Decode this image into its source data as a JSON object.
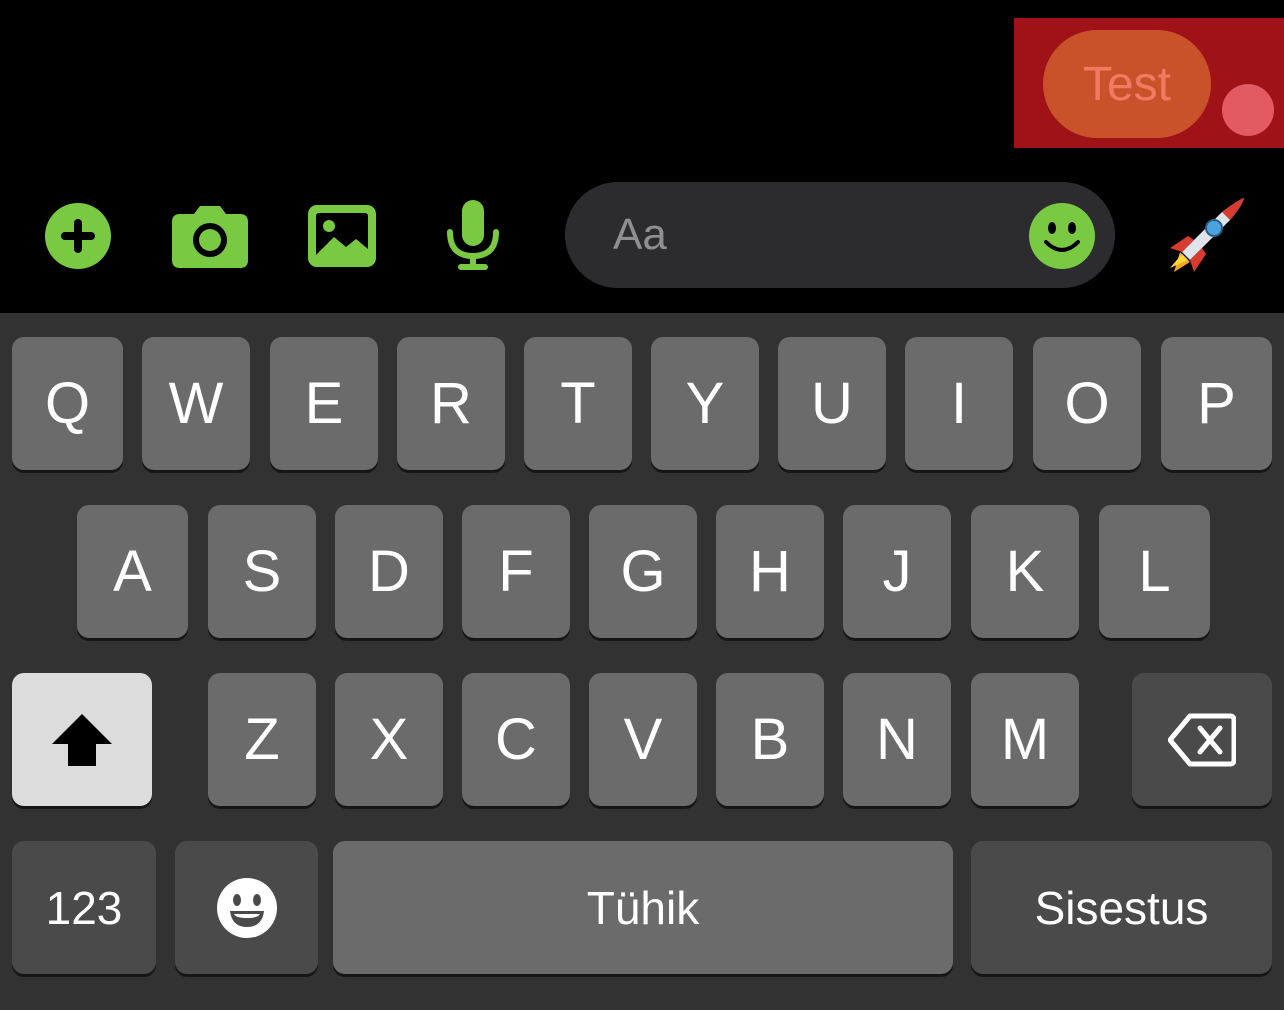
{
  "message": {
    "text": "Test"
  },
  "composer": {
    "placeholder": "Aa",
    "icons": {
      "add": "plus-circle-icon",
      "camera": "camera-icon",
      "gallery": "image-icon",
      "voice": "microphone-icon",
      "emoji": "smiley-icon",
      "quick_reaction": "rocket-icon"
    },
    "accent_color": "#7ac943"
  },
  "keyboard": {
    "row1": [
      "Q",
      "W",
      "E",
      "R",
      "T",
      "Y",
      "U",
      "I",
      "O",
      "P"
    ],
    "row2": [
      "A",
      "S",
      "D",
      "F",
      "G",
      "H",
      "J",
      "K",
      "L"
    ],
    "row3": [
      "Z",
      "X",
      "C",
      "V",
      "B",
      "N",
      "M"
    ],
    "numbers_label": "123",
    "space_label": "Tühik",
    "return_label": "Sisestus",
    "icons": {
      "shift": "shift-arrow-icon",
      "backspace": "backspace-icon",
      "emoji": "emoji-keyboard-icon"
    }
  },
  "colors": {
    "highlight": "#9e1218",
    "bubble": "#c9522b",
    "key": "#6b6b6b",
    "keyboard_bg": "#323232"
  }
}
